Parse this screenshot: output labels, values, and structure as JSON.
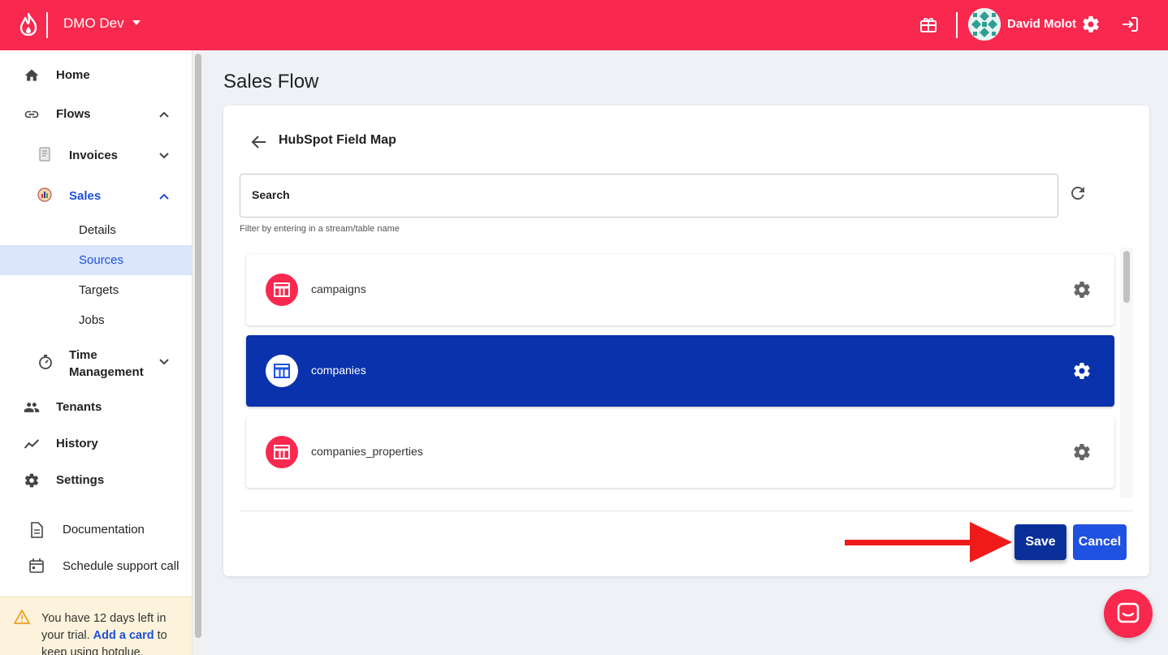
{
  "colors": {
    "brand": "#f9284f",
    "selected_row": "#0a32ad",
    "save_button": "#0a2f99",
    "cancel_button": "#1f52e0",
    "nav_active": "#dbe5fb",
    "link": "#1f4fd8"
  },
  "header": {
    "org_name": "DMO Dev",
    "user_name": "David Molot",
    "icons": [
      "flame-logo-icon",
      "caret-down-icon",
      "gift-icon",
      "avatar",
      "gear-icon",
      "logout-icon"
    ]
  },
  "sidebar": {
    "home": "Home",
    "flows": "Flows",
    "invoices": "Invoices",
    "sales": "Sales",
    "sales_items": [
      "Details",
      "Sources",
      "Targets",
      "Jobs"
    ],
    "active_item": "Sources",
    "time_management": "Time Management",
    "tenants": "Tenants",
    "history": "History",
    "settings": "Settings",
    "documentation": "Documentation",
    "schedule_support": "Schedule support call",
    "trial": {
      "before": "You have 12 days left in your trial.",
      "link": "Add a card",
      "after": "to keep using hotglue."
    }
  },
  "main": {
    "page_title": "Sales Flow",
    "card_heading": "HubSpot Field Map",
    "search_label": "Search",
    "search_help": "Filter by entering in a stream/table name",
    "streams": [
      {
        "name": "campaigns",
        "selected": false
      },
      {
        "name": "companies",
        "selected": true
      },
      {
        "name": "companies_properties",
        "selected": false
      }
    ],
    "save_label": "Save",
    "cancel_label": "Cancel"
  }
}
